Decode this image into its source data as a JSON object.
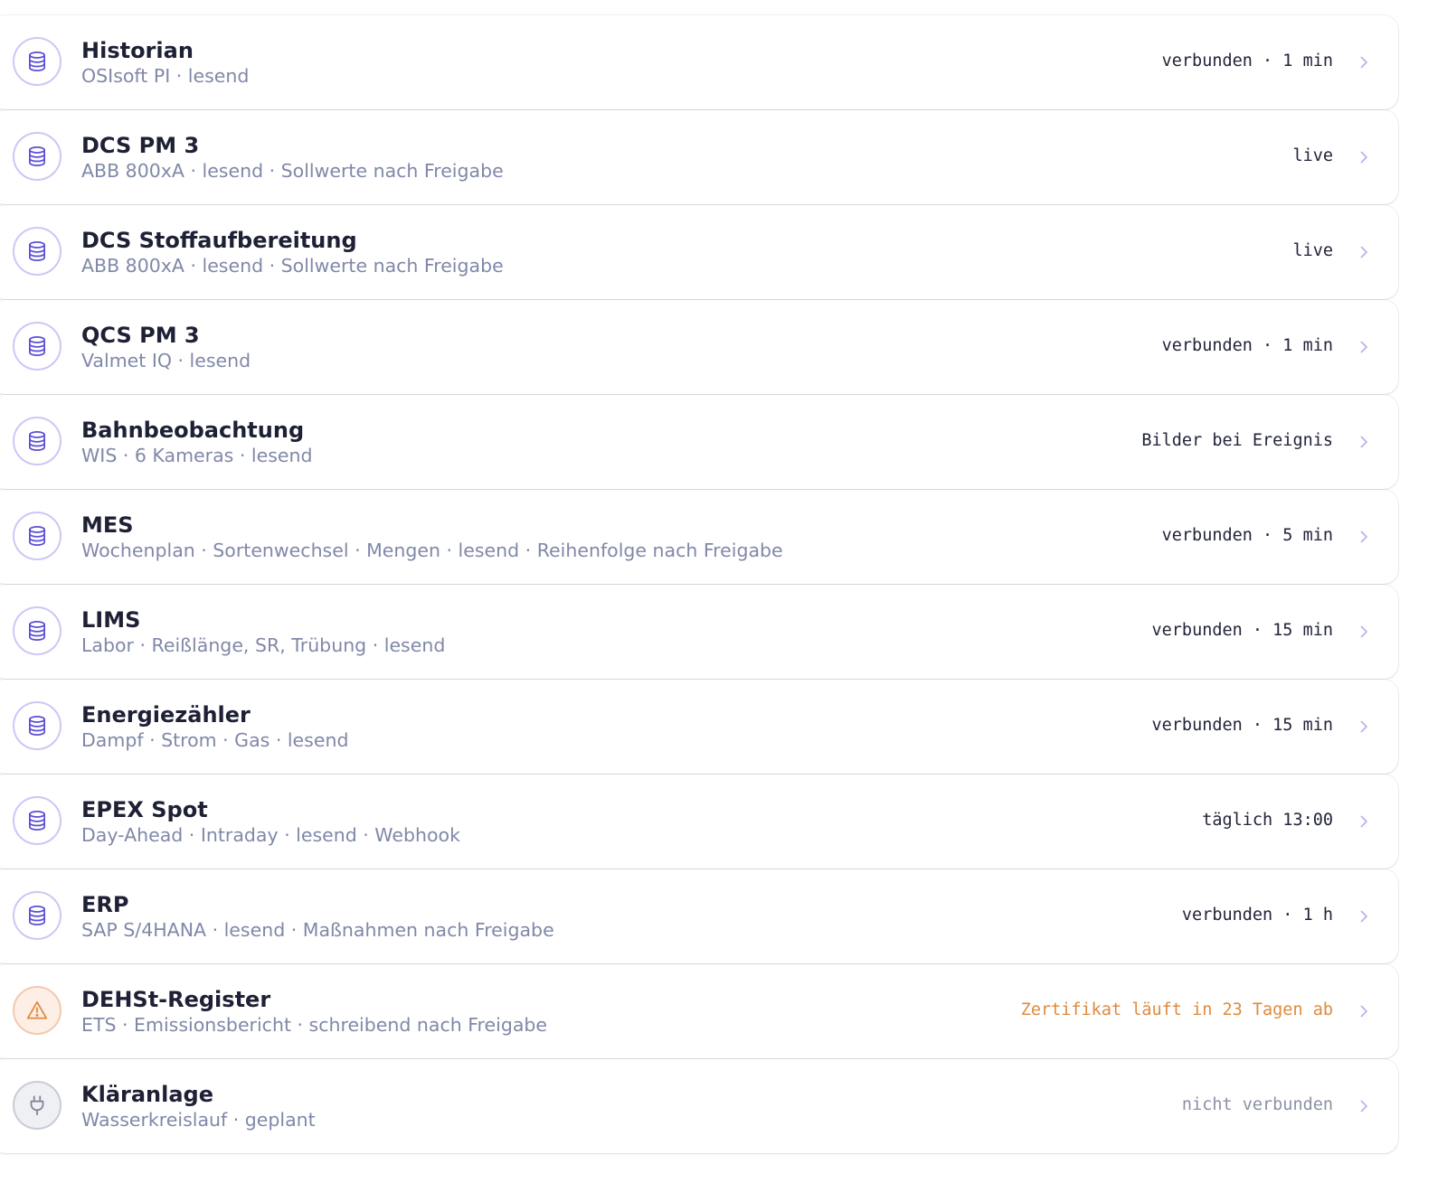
{
  "connections": [
    {
      "title": "Historian",
      "subtitle": "OSIsoft PI · lesend",
      "status": "verbunden · 1 min",
      "icon": "database-icon",
      "state": "ok"
    },
    {
      "title": "DCS PM 3",
      "subtitle": "ABB 800xA · lesend · Sollwerte nach Freigabe",
      "status": "live",
      "icon": "database-icon",
      "state": "ok"
    },
    {
      "title": "DCS Stoffaufbereitung",
      "subtitle": "ABB 800xA · lesend · Sollwerte nach Freigabe",
      "status": "live",
      "icon": "database-icon",
      "state": "ok"
    },
    {
      "title": "QCS PM 3",
      "subtitle": "Valmet IQ · lesend",
      "status": "verbunden · 1 min",
      "icon": "database-icon",
      "state": "ok"
    },
    {
      "title": "Bahnbeobachtung",
      "subtitle": "WIS · 6 Kameras · lesend",
      "status": "Bilder bei Ereignis",
      "icon": "database-icon",
      "state": "ok"
    },
    {
      "title": "MES",
      "subtitle": "Wochenplan · Sortenwechsel · Mengen · lesend · Reihenfolge nach Freigabe",
      "status": "verbunden · 5 min",
      "icon": "database-icon",
      "state": "ok"
    },
    {
      "title": "LIMS",
      "subtitle": "Labor · Reißlänge, SR, Trübung · lesend",
      "status": "verbunden · 15 min",
      "icon": "database-icon",
      "state": "ok"
    },
    {
      "title": "Energiezähler",
      "subtitle": "Dampf · Strom · Gas · lesend",
      "status": "verbunden · 15 min",
      "icon": "database-icon",
      "state": "ok"
    },
    {
      "title": "EPEX Spot",
      "subtitle": "Day-Ahead · Intraday · lesend · Webhook",
      "status": "täglich 13:00",
      "icon": "database-icon",
      "state": "ok"
    },
    {
      "title": "ERP",
      "subtitle": "SAP S/4HANA · lesend · Maßnahmen nach Freigabe",
      "status": "verbunden · 1 h",
      "icon": "database-icon",
      "state": "ok"
    },
    {
      "title": "DEHSt-Register",
      "subtitle": "ETS · Emissionsbericht · schreibend nach Freigabe",
      "status": "Zertifikat läuft in 23 Tagen ab",
      "icon": "warning-icon",
      "state": "warn"
    },
    {
      "title": "Kläranlage",
      "subtitle": "Wasserkreislauf · geplant",
      "status": "nicht verbunden",
      "icon": "plug-icon",
      "state": "off"
    }
  ],
  "colors": {
    "accent": "#5b4fd6",
    "warning": "#e08a3c",
    "muted": "#8b90a6"
  }
}
